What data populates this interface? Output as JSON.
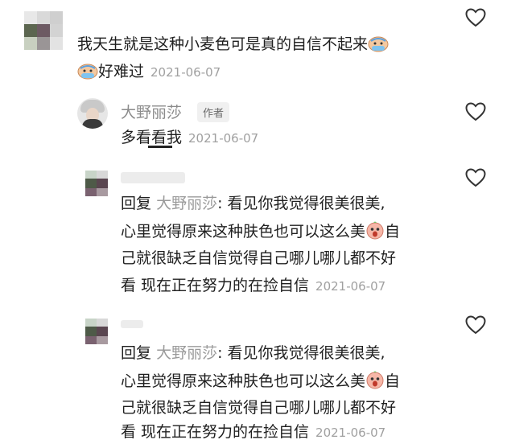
{
  "comments": [
    {
      "text": "我天生就是这种小麦色可是真的自信不起来",
      "text_end_emoji": "crying-emoji",
      "line2_prefix_emoji": "crying-emoji",
      "line2_text": "好难过",
      "date": "2021-06-07",
      "like_icon": "heart-outline-icon"
    },
    {
      "author": "大野丽莎",
      "author_tag": "作者",
      "text": "多看看我",
      "date": "2021-06-07",
      "like_icon": "heart-outline-icon"
    },
    {
      "reply_keyword": "回复",
      "reply_target": "大野丽莎",
      "line1": ": 看见你我觉得很美很美,",
      "line2": "心里觉得原来这种肤色也可以这么美",
      "line2_emoji": "shocked-face-emoji",
      "line2_end": "自",
      "line3": "己就很缺乏自信觉得自己哪儿哪儿都不好",
      "line4": "看 现在正在努力的在捡自信",
      "date": "2021-06-07",
      "like_icon": "heart-outline-icon"
    },
    {
      "reply_keyword": "回复",
      "reply_target": "大野丽莎",
      "line1": ": 看见你我觉得很美很美,",
      "line2": "心里觉得原来这种肤色也可以这么美",
      "line2_emoji": "shocked-face-emoji",
      "line2_end": "自",
      "line3": "己就很缺乏自信觉得自己哪儿哪儿都不好",
      "line4": "看 现在正在努力的在捡自信",
      "date": "2021-06-07",
      "like_icon": "heart-outline-icon"
    }
  ],
  "colors": {
    "text": "#1f1f1f",
    "meta": "#a0a0a0",
    "author": "#8c8c8c",
    "tag_bg": "#f0f0f0"
  }
}
